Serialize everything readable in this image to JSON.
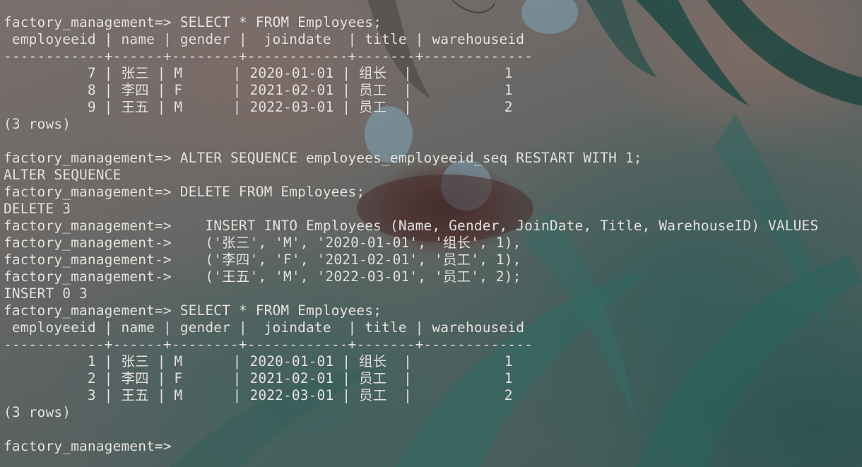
{
  "terminal": {
    "prompt": "factory_management=>",
    "continuation_prompt": "factory_management->",
    "lines": [
      "factory_management=> SELECT * FROM Employees;",
      " employeeid | name | gender |  joindate  | title | warehouseid",
      "------------+------+--------+------------+-------+-------------",
      "          7 | 张三 | M      | 2020-01-01 | 组长  |           1",
      "          8 | 李四 | F      | 2021-02-01 | 员工  |           1",
      "          9 | 王五 | M      | 2022-03-01 | 员工  |           2",
      "(3 rows)",
      "",
      "factory_management=> ALTER SEQUENCE employees_employeeid_seq RESTART WITH 1;",
      "ALTER SEQUENCE",
      "factory_management=> DELETE FROM Employees;",
      "DELETE 3",
      "factory_management=>    INSERT INTO Employees (Name, Gender, JoinDate, Title, WarehouseID) VALUES",
      "factory_management->    ('张三', 'M', '2020-01-01', '组长', 1),",
      "factory_management->    ('李四', 'F', '2021-02-01', '员工', 1),",
      "factory_management->    ('王五', 'M', '2022-03-01', '员工', 2);",
      "INSERT 0 3",
      "factory_management=> SELECT * FROM Employees;",
      " employeeid | name | gender |  joindate  | title | warehouseid",
      "------------+------+--------+------------+-------+-------------",
      "          1 | 张三 | M      | 2020-01-01 | 组长  |           1",
      "          2 | 李四 | F      | 2021-02-01 | 员工  |           1",
      "          3 | 王五 | M      | 2022-03-01 | 员工  |           2",
      "(3 rows)",
      "",
      "factory_management=> "
    ],
    "text_color": "#eceae6"
  }
}
